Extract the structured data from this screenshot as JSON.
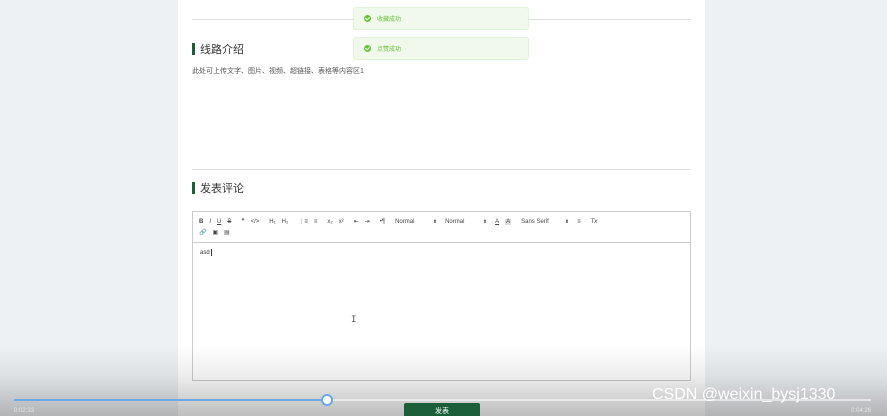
{
  "toasts": [
    {
      "message": "收藏成功"
    },
    {
      "message": "点赞成功"
    }
  ],
  "route_intro": {
    "title": "线路介绍",
    "content": "此处可上传文字、图片、视频、超链接、表格等内容区1"
  },
  "comment": {
    "title": "发表评论",
    "editor_content": "asd",
    "submit_label": "发表"
  },
  "toolbar": {
    "bold": "B",
    "italic": "I",
    "underline": "U",
    "strike": "S",
    "blockquote": "❞",
    "code": "</>",
    "h1": "H₁",
    "h2": "H₂",
    "ordered_list": "⋮≡",
    "bullet_list": "≡",
    "subscript": "x₂",
    "superscript": "x²",
    "indent_left": "⇤",
    "indent_right": "⇥",
    "direction": "•¶",
    "size_select": "Normal",
    "header_select": "Normal",
    "font_color": "A",
    "background_color": "A",
    "font_select": "Sans Serif",
    "align": "≡",
    "clean": "Tx",
    "link": "🔗",
    "image": "▣",
    "video": "▤"
  },
  "video_player": {
    "current_time": "0:02:33",
    "duration": "0:04:26",
    "progress": 0.365,
    "accent_color": "#6aa9e6"
  },
  "watermark": "CSDN @weixin_bysj1330",
  "colors": {
    "brand_green": "#1b5e3a",
    "success_green": "#67c23a"
  }
}
